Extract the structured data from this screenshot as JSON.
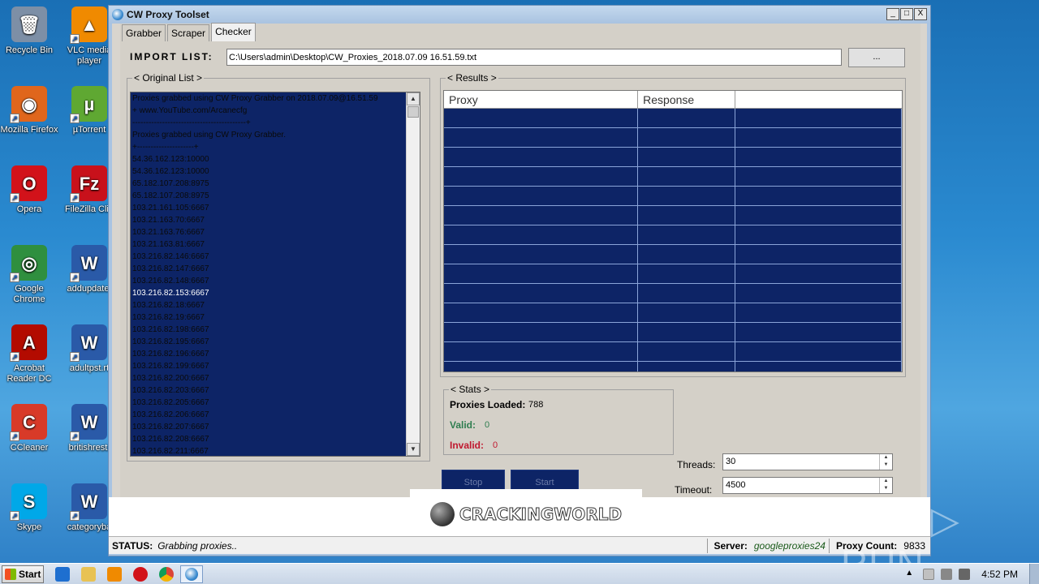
{
  "desktop": {
    "icons": [
      {
        "label": "Recycle Bin",
        "glyph": "🗑",
        "color": "#7d8fa6"
      },
      {
        "label": "VLC media player",
        "glyph": "▲",
        "color": "#f08a00"
      },
      {
        "label": "Mozilla Firefox",
        "glyph": "◉",
        "color": "#e0661c"
      },
      {
        "label": "µTorrent",
        "glyph": "µ",
        "color": "#5fa832"
      },
      {
        "label": "Opera",
        "glyph": "O",
        "color": "#d2121a"
      },
      {
        "label": "FileZilla Clie",
        "glyph": "Fz",
        "color": "#c8111b"
      },
      {
        "label": "Google Chrome",
        "glyph": "◎",
        "color": "#2f8f3f"
      },
      {
        "label": "addupdate.",
        "glyph": "W",
        "color": "#2a5aa8"
      },
      {
        "label": "Acrobat Reader DC",
        "glyph": "A",
        "color": "#b30b00"
      },
      {
        "label": "adultpst.rt",
        "glyph": "W",
        "color": "#2a5aa8"
      },
      {
        "label": "CCleaner",
        "glyph": "C",
        "color": "#d83a28"
      },
      {
        "label": "britishrest.",
        "glyph": "W",
        "color": "#2a5aa8"
      },
      {
        "label": "Skype",
        "glyph": "S",
        "color": "#00a8e8"
      },
      {
        "label": "categoryba",
        "glyph": "W",
        "color": "#2a5aa8"
      }
    ]
  },
  "window": {
    "title": "CW Proxy Toolset",
    "controls": {
      "minimize": "_",
      "maximize": "□",
      "close": "X"
    }
  },
  "tabs": [
    {
      "label": "Grabber"
    },
    {
      "label": "Scraper"
    },
    {
      "label": "Checker"
    }
  ],
  "import": {
    "label": "IMPORT LIST:",
    "path": "C:\\Users\\admin\\Desktop\\CW_Proxies_2018.07.09 16.51.59.txt",
    "browse_label": "..."
  },
  "original_list": {
    "legend": "< Original List >",
    "lines": [
      "Proxies grabbed using CW Proxy Grabber on 2018.07.09@16.51.59",
      "+ www.YouTube.com/Arcanecfg",
      "------------------------------------------+",
      "Proxies grabbed using CW Proxy Grabber.",
      "+---------------------+",
      "54.36.162.123:10000",
      "54.36.162.123:10000",
      "65.182.107.208:8975",
      "65.182.107.208:8975",
      "103.21.161.105:6667",
      "103.21.163.70:6667",
      "103.21.163.76:6667",
      "103.21.163.81:6667",
      "103.216.82.146:6667",
      "103.216.82.147:6667",
      "103.216.82.148:6667",
      "103.216.82.153:6667",
      "103.216.82.18:6667",
      "103.216.82.19:6667",
      "103.216.82.198:6667",
      "103.216.82.195:6667",
      "103.216.82.196:6667",
      "103.216.82.199:6667",
      "103.216.82.200:6667",
      "103.216.82.203:6667",
      "103.216.82.205:6667",
      "103.216.82.206:6667",
      "103.216.82.207:6667",
      "103.216.82.208:6667",
      "103.216.82.211:6667"
    ],
    "selected_index": 16
  },
  "results": {
    "legend": "< Results >",
    "columns": [
      "Proxy",
      "Response",
      ""
    ],
    "row_count": 14
  },
  "stats": {
    "legend": "< Stats >",
    "loaded_label": "Proxies Loaded:",
    "loaded_value": "788",
    "valid_label": "Valid:",
    "valid_value": "0",
    "invalid_label": "Invalid:",
    "invalid_value": "0",
    "valid_color": "#2e7d4f",
    "invalid_color": "#c0182f"
  },
  "actions": {
    "stop_label": "Stop",
    "start_label": "Start"
  },
  "settings": {
    "threads_label": "Threads:",
    "threads_value": "30",
    "timeout_label": "Timeout:",
    "timeout_value": "4500"
  },
  "logo": {
    "text": "CRACKINGWORLD"
  },
  "statusbar": {
    "status_label": "STATUS:",
    "status_value": "Grabbing proxies..",
    "server_label": "Server:",
    "server_value": "googleproxies24",
    "count_label": "Proxy Count:",
    "count_value": "9833"
  },
  "watermark": "ANY ▷ RUN",
  "taskbar": {
    "start_label": "Start",
    "clock": "4:52 PM"
  }
}
